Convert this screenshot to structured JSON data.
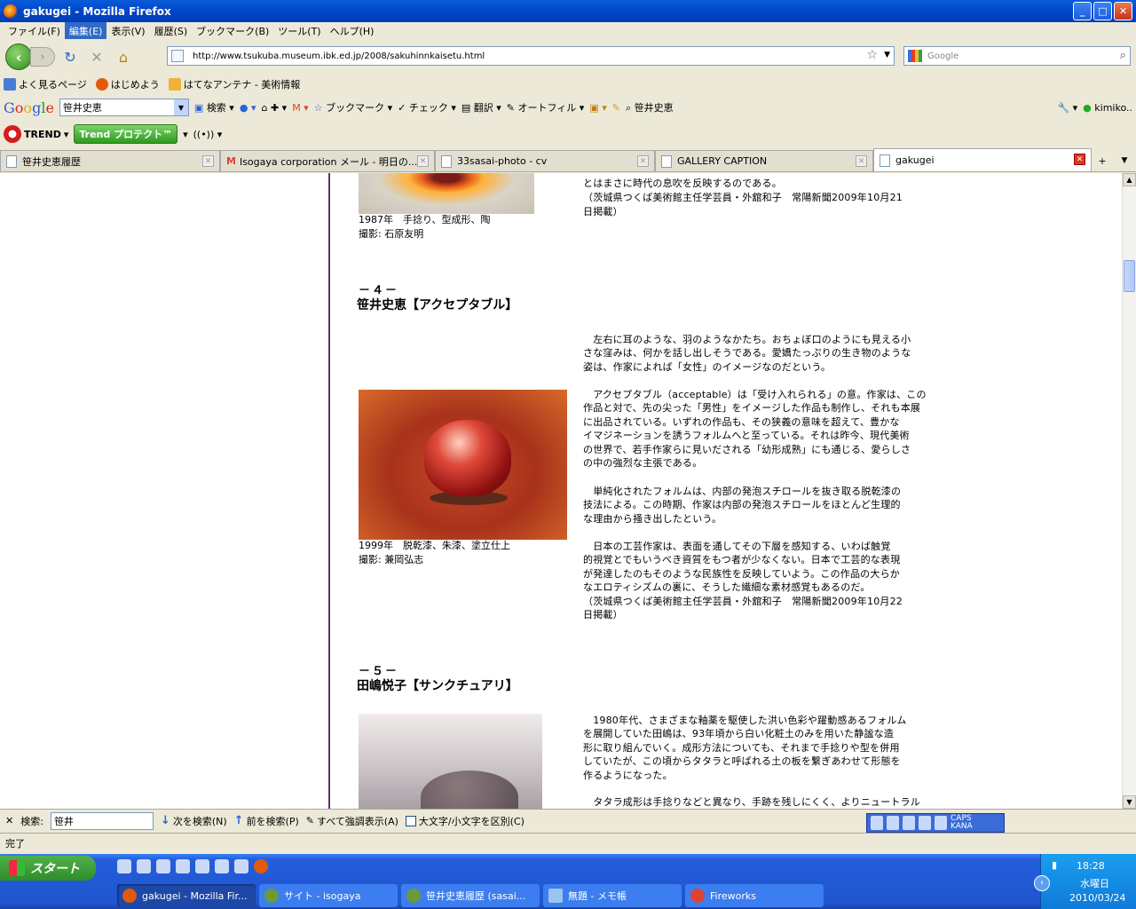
{
  "window": {
    "title": "gakugei - Mozilla Firefox"
  },
  "menu": [
    "ファイル(F)",
    "編集(E)",
    "表示(V)",
    "履歴(S)",
    "ブックマーク(B)",
    "ツール(T)",
    "ヘルプ(H)"
  ],
  "nav": {
    "url": "http://www.tsukuba.museum.ibk.ed.jp/2008/sakuhinnkaisetu.html",
    "search_placeholder": "Google"
  },
  "bookmarks": [
    "よく見るページ",
    "はじめよう",
    "はてなアンテナ - 美術情報"
  ],
  "gtoolbar": {
    "logo": "Google",
    "query": "笹井史恵",
    "search": "検索",
    "bookmarks": "ブックマーク",
    "check": "チェック",
    "translate": "翻訳",
    "autofill": "オートフィル",
    "name": "笹井史恵",
    "user": "kimiko.."
  },
  "trend": {
    "brand": "TREND",
    "protect": "Trend プロテクト™"
  },
  "tabs": [
    {
      "label": "笹井史恵履歴",
      "icon": "page-icon"
    },
    {
      "label": "Isogaya corporation メール - 明日の...",
      "icon": "gmail-icon"
    },
    {
      "label": "33sasai-photo - cv",
      "icon": "page-icon"
    },
    {
      "label": "GALLERY CAPTION",
      "icon": "page-icon"
    },
    {
      "label": "gakugei",
      "icon": "page-icon"
    }
  ],
  "page": {
    "top_text": [
      "とはまさに時代の息吹を反映するのである。",
      "（茨城県つくば美術館主任学芸員・外舘和子　常陽新聞2009年10月21",
      "日掲載）"
    ],
    "cap1": [
      "1987年　手捻り、型成形、陶",
      "撮影: 石原友明"
    ],
    "sec4": {
      "num": "－４－",
      "title": "笹井史恵【アクセプタブル】"
    },
    "p4_1": [
      "　左右に耳のような、羽のようなかたち。おちょぼ口のようにも見える小",
      "さな窪みは、何かを話し出しそうである。愛嬌たっぷりの生き物のような",
      "姿は、作家によれば「女性」のイメージなのだという。"
    ],
    "p4_2": [
      "　アクセプタブル（acceptable）は「受け入れられる」の意。作家は、この",
      "作品と対で、先の尖った「男性」をイメージした作品も制作し、それも本展",
      "に出品されている。いずれの作品も、その狭義の意味を超えて、豊かな",
      "イマジネーションを誘うフォルムへと至っている。それは昨今、現代美術",
      "の世界で、若手作家らに見いだされる「幼形成熟」にも通じる、愛らしさ",
      "の中の強烈な主張である。"
    ],
    "p4_3": [
      "　単純化されたフォルムは、内部の発泡スチロールを抜き取る脱乾漆の",
      "技法による。この時期、作家は内部の発泡スチロールをほとんど生理的",
      "な理由から掻き出したという。"
    ],
    "p4_4": [
      "　日本の工芸作家は、表面を通してその下層を感知する、いわば触覚",
      "的視覚とでもいうべき資質をもつ者が少なくない。日本で工芸的な表現",
      "が発達したのもそのような民族性を反映していよう。この作品の大らか",
      "なエロティシズムの裏に、そうした繊細な素材感覚もあるのだ。",
      "（茨城県つくば美術館主任学芸員・外舘和子　常陽新聞2009年10月22",
      "日掲載）"
    ],
    "cap2": [
      "1999年　脱乾漆、朱漆、塗立仕上",
      "撮影: 兼岡弘志"
    ],
    "sec5": {
      "num": "－５－",
      "title": "田嶋悦子【サンクチュアリ】"
    },
    "p5_1": [
      "　1980年代、さまざまな釉薬を駆使した洪い色彩や躍動感あるフォルム",
      "を展開していた田嶋は、93年頃から白い化粧土のみを用いた静謐な造",
      "形に取り組んでいく。成形方法についても、それまで手捻りや型を併用",
      "していたが、この頃からタタラと呼ばれる土の板を繋ぎあわせて形態を",
      "作るようになった。"
    ],
    "p5_2": [
      "　タタラ成形は手捻りなどと異なり、手跡を残しにくく、よりニュートラルな"
    ]
  },
  "find": {
    "label": "検索:",
    "value": "笹井",
    "next": "次を検索(N)",
    "prev": "前を検索(P)",
    "highlight": "すべて強調表示(A)",
    "case": "大文字/小文字を区別(C)"
  },
  "ime": {
    "caps": "CAPS",
    "kana": "KANA"
  },
  "status": "完了",
  "taskbar": {
    "start": "スタート",
    "items": [
      "gakugei - Mozilla Fir...",
      "サイト - isogaya",
      "笹井史恵履歴 (sasai...",
      "無題 - メモ帳",
      "Fireworks"
    ],
    "time": "18:28",
    "day": "水曜日",
    "date": "2010/03/24"
  },
  "colors": {
    "accent": "#316ac5",
    "divider": "#6e2a74",
    "taskbar": "#245edb"
  }
}
